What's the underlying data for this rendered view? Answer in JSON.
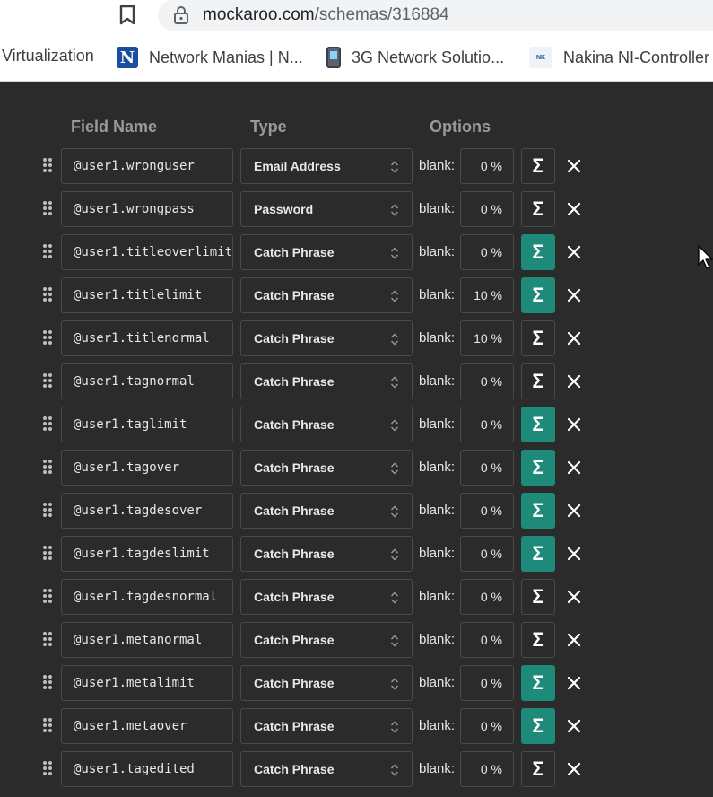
{
  "browser": {
    "url_host": "mockaroo.com",
    "url_path": "/schemas/316884",
    "bookmarks": [
      {
        "label": "Virtualization",
        "icon": "none"
      },
      {
        "label": "Network Manias | N...",
        "icon": "n-logo-icon"
      },
      {
        "label": "3G Network Solutio...",
        "icon": "phone-icon"
      },
      {
        "label": "Nakina NI-Controller",
        "icon": "nakina-logo-icon"
      }
    ]
  },
  "table": {
    "headers": {
      "field_name": "Field Name",
      "type": "Type",
      "options": "Options"
    },
    "blank_label": "blank:",
    "rows": [
      {
        "name": "@user1.wronguser",
        "type": "Email Address",
        "blank": "0 %",
        "sigma_active": false
      },
      {
        "name": "@user1.wrongpass",
        "type": "Password",
        "blank": "0 %",
        "sigma_active": false
      },
      {
        "name": "@user1.titleoverlimit",
        "type": "Catch Phrase",
        "blank": "0 %",
        "sigma_active": true
      },
      {
        "name": "@user1.titlelimit",
        "type": "Catch Phrase",
        "blank": "10 %",
        "sigma_active": true
      },
      {
        "name": "@user1.titlenormal",
        "type": "Catch Phrase",
        "blank": "10 %",
        "sigma_active": false
      },
      {
        "name": "@user1.tagnormal",
        "type": "Catch Phrase",
        "blank": "0 %",
        "sigma_active": false
      },
      {
        "name": "@user1.taglimit",
        "type": "Catch Phrase",
        "blank": "0 %",
        "sigma_active": true
      },
      {
        "name": "@user1.tagover",
        "type": "Catch Phrase",
        "blank": "0 %",
        "sigma_active": true
      },
      {
        "name": "@user1.tagdesover",
        "type": "Catch Phrase",
        "blank": "0 %",
        "sigma_active": true
      },
      {
        "name": "@user1.tagdeslimit",
        "type": "Catch Phrase",
        "blank": "0 %",
        "sigma_active": true
      },
      {
        "name": "@user1.tagdesnormal",
        "type": "Catch Phrase",
        "blank": "0 %",
        "sigma_active": false
      },
      {
        "name": "@user1.metanormal",
        "type": "Catch Phrase",
        "blank": "0 %",
        "sigma_active": false
      },
      {
        "name": "@user1.metalimit",
        "type": "Catch Phrase",
        "blank": "0 %",
        "sigma_active": true
      },
      {
        "name": "@user1.metaover",
        "type": "Catch Phrase",
        "blank": "0 %",
        "sigma_active": true
      },
      {
        "name": "@user1.tagedited",
        "type": "Catch Phrase",
        "blank": "0 %",
        "sigma_active": false
      }
    ]
  },
  "colors": {
    "sigma_active": "#1e8a7a",
    "background": "#2b2b2b"
  }
}
